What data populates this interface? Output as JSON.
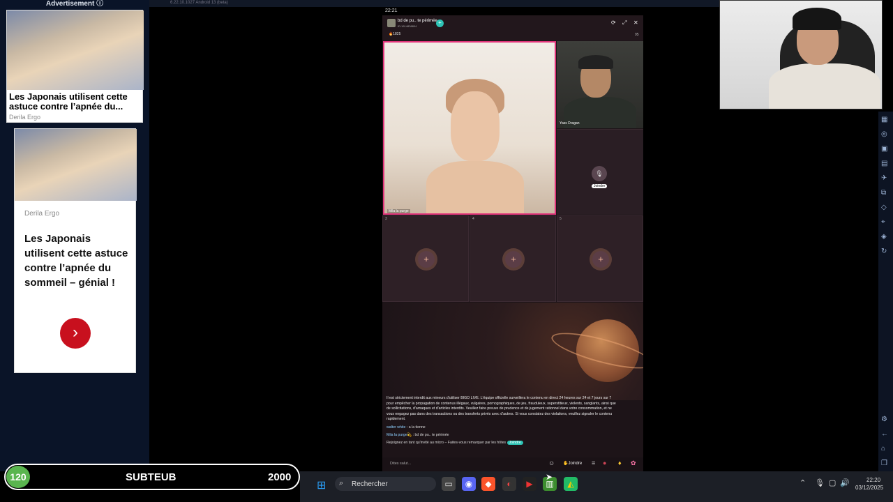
{
  "advertisement": {
    "header": "Advertisement ⓘ",
    "ad1": {
      "title": "Les Japonais utilisent cette astuce contre l’apnée du...",
      "source": "Derila Ergo"
    },
    "ad2": {
      "source": "Derila Ergo",
      "title": "Les Japonais utilisent cette astuce contre l’apnée du sommeil – génial !",
      "cta_icon": "›"
    }
  },
  "emulator": {
    "topbar_text": "6.22.10.1027 Android 13 (beta)",
    "phone_time": "22:21"
  },
  "stream": {
    "room_name": "bd de pu.. te périmée",
    "room_id": "ID:1614838804",
    "viewer_count": "🔥1825",
    "viewers_num": "95",
    "host_label": "Mila la purge",
    "guest_label": "Yass Dragan",
    "join_label": "Joindre",
    "seat_numbers": [
      "3",
      "4",
      "5"
    ],
    "seat_plus": "+",
    "notice": "Il est strictement interdit aux mineurs d'utiliser BIGO LIVE. L'équipe officielle surveillera le contenu en direct 24 heures sur 24 et 7 jours sur 7 pour empêcher la propagation de contenus illégaux, vulgaires, pornographiques, de jeu, frauduleux, superstitieux, violents, sanglants, ainsi que de sollicitations, d'arnaques et d'articles interdits. Veuillez faire preuve de prudence et de jugement rationnel dans votre consommation, et ne vous engagez pas dans des transactions ou des transferts privés avec d'autres. Si vous constatez des violations, veuillez signaler le contenu rapidement.",
    "chat": [
      {
        "user": "walter white",
        "text": ": a la tienne"
      },
      {
        "user": "Mila la purge💫",
        "text": ": bd de pu.. te périmée"
      },
      {
        "user": "",
        "text": "Rejoignez en tant qu'invité au micro – Faites-vous remarquer par les hôtes"
      }
    ],
    "join_chip": "Joindre",
    "say_hi_placeholder": "Dites salut...",
    "bottom_join": "✋Joindre"
  },
  "subgoal": {
    "current": "120",
    "label": "SUBTEUB",
    "goal": "2000"
  },
  "taskbar": {
    "search_placeholder": "Rechercher",
    "time": "22:20",
    "date": "03/12/2025"
  },
  "colors": {
    "accent": "#2ec4b6",
    "host_border": "#e0347a",
    "sub_badge": "#5ab54f",
    "ad_cta": "#c8101e"
  }
}
